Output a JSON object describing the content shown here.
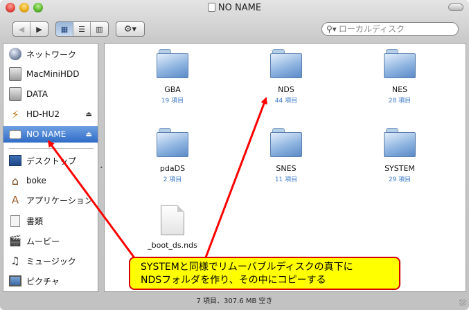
{
  "window": {
    "title": "NO NAME"
  },
  "toolbar": {
    "back_glyph": "◀",
    "forward_glyph": "▶",
    "view_icon": "▦",
    "view_list": "☰",
    "view_columns": "▥",
    "action_glyph": "⚙▾",
    "search_glyph": "⚲▾",
    "search_placeholder": "ローカルディスク"
  },
  "sidebar": {
    "items": [
      {
        "label": "ネットワーク",
        "icon": "network-globe-icon"
      },
      {
        "label": "MacMiniHDD",
        "icon": "hard-disk-icon"
      },
      {
        "label": "DATA",
        "icon": "hard-disk-icon"
      },
      {
        "label": "HD-HU2",
        "icon": "usb-drive-icon",
        "eject": "⏏"
      },
      {
        "label": "NO NAME",
        "icon": "removable-disk-icon",
        "eject": "⏏",
        "selected": true
      },
      {
        "label": "デスクトップ",
        "icon": "desktop-icon"
      },
      {
        "label": "boke",
        "icon": "home-icon"
      },
      {
        "label": "アプリケーション",
        "icon": "applications-icon"
      },
      {
        "label": "書類",
        "icon": "documents-icon"
      },
      {
        "label": "ムービー",
        "icon": "movies-icon"
      },
      {
        "label": "ミュージック",
        "icon": "music-icon"
      },
      {
        "label": "ピクチャ",
        "icon": "pictures-icon"
      }
    ],
    "icon_glyphs": {
      "usb": "⚡",
      "home": "⌂",
      "app": "A",
      "movie": "🎬",
      "music": "♫"
    }
  },
  "files": [
    {
      "name": "GBA",
      "count": "19 項目",
      "kind": "folder"
    },
    {
      "name": "NDS",
      "count": "44 項目",
      "kind": "folder"
    },
    {
      "name": "NES",
      "count": "28 項目",
      "kind": "folder"
    },
    {
      "name": "pdaDS",
      "count": "2 項目",
      "kind": "folder"
    },
    {
      "name": "SNES",
      "count": "11 項目",
      "kind": "folder"
    },
    {
      "name": "SYSTEM",
      "count": "29 項目",
      "kind": "folder"
    },
    {
      "name": "_boot_ds.nds",
      "kind": "file"
    }
  ],
  "status": {
    "text": "7 項目、307.6 MB 空き"
  },
  "annotation": {
    "line1": "SYSTEMと同様でリムーバブルディスクの真下に",
    "line2": "NDSフォルダを作り、その中にコピーする",
    "color": "#ff0000",
    "fill": "#ffff00"
  }
}
